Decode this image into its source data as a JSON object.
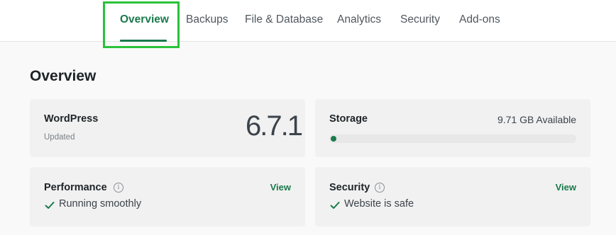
{
  "tabs": [
    {
      "label": "Overview",
      "active": true
    },
    {
      "label": "Backups"
    },
    {
      "label": "File & Database"
    },
    {
      "label": "Analytics"
    },
    {
      "label": "Security"
    },
    {
      "label": "Add-ons"
    }
  ],
  "page": {
    "title": "Overview"
  },
  "wordpress_card": {
    "title": "WordPress",
    "status": "Updated",
    "version": "6.7.1"
  },
  "storage_card": {
    "title": "Storage",
    "available": "9.71 GB Available",
    "used_fraction": 0.0
  },
  "performance_card": {
    "title": "Performance",
    "info_icon": "info-icon",
    "view_label": "View",
    "status": "Running smoothly",
    "status_icon": "check-icon"
  },
  "security_card": {
    "title": "Security",
    "info_icon": "info-icon",
    "view_label": "View",
    "status": "Website is safe",
    "status_icon": "check-icon"
  },
  "colors": {
    "accent": "#1a7a4c",
    "focus_outline": "#29c23a"
  }
}
